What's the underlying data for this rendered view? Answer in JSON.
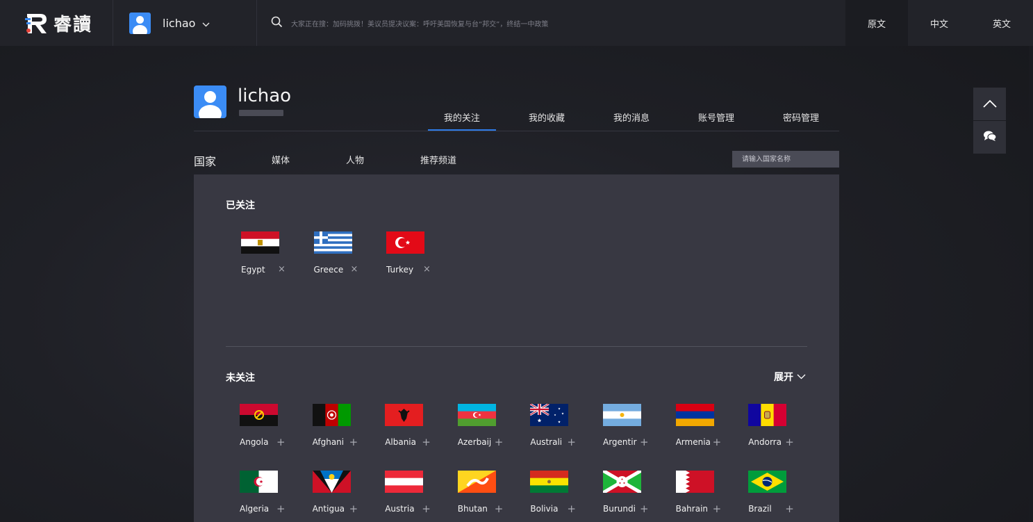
{
  "topbar": {
    "logo_text": "睿讀",
    "user_name": "lichao",
    "search_hint": "大家正在搜：加码挑拨！美议员提决议案：呼吁美国恢复与台“邦交”，终结一中政策",
    "languages": [
      "原文",
      "中文",
      "英文"
    ],
    "active_language": "原文"
  },
  "profile": {
    "name": "lichao",
    "tabs": [
      "我的关注",
      "我的收藏",
      "我的消息",
      "账号管理",
      "密码管理"
    ],
    "active_tab": "我的关注"
  },
  "subnav": {
    "items": [
      "国家",
      "媒体",
      "人物",
      "推荐频道"
    ],
    "search_placeholder": "请输入国家名称"
  },
  "followed": {
    "title": "已关注",
    "remove_symbol": "×",
    "countries": [
      {
        "name": "Egypt",
        "flag": "egypt-flag"
      },
      {
        "name": "Greece",
        "flag": "greece-flag"
      },
      {
        "name": "Turkey",
        "flag": "turkey-flag"
      }
    ]
  },
  "unfollowed": {
    "title": "未关注",
    "expand_label": "展开",
    "add_symbol": "+",
    "countries": [
      {
        "name": "Angola",
        "flag": "angola-flag"
      },
      {
        "name": "Afghani",
        "flag": "afghanistan-flag"
      },
      {
        "name": "Albania",
        "flag": "albania-flag"
      },
      {
        "name": "Azerbaij",
        "flag": "azerbaijan-flag"
      },
      {
        "name": "Australi",
        "flag": "australia-flag"
      },
      {
        "name": "Argentir",
        "flag": "argentina-flag"
      },
      {
        "name": "Armenia",
        "flag": "armenia-flag"
      },
      {
        "name": "Andorra",
        "flag": "andorra-flag"
      },
      {
        "name": "Algeria",
        "flag": "algeria-flag"
      },
      {
        "name": "Antigua",
        "flag": "antigua-flag"
      },
      {
        "name": "Austria",
        "flag": "austria-flag"
      },
      {
        "name": "Bhutan",
        "flag": "bhutan-flag"
      },
      {
        "name": "Bolivia",
        "flag": "bolivia-flag"
      },
      {
        "name": "Burundi",
        "flag": "burundi-flag"
      },
      {
        "name": "Bahrain",
        "flag": "bahrain-flag"
      },
      {
        "name": "Brazil",
        "flag": "brazil-flag"
      }
    ]
  },
  "floating": {
    "icons": [
      "chevron-up-icon",
      "chat-bubble-icon"
    ]
  },
  "colors": {
    "accent": "#2e7be8",
    "avatar": "#3b8cf5",
    "panel": "#383842",
    "topbar": "#222329"
  }
}
